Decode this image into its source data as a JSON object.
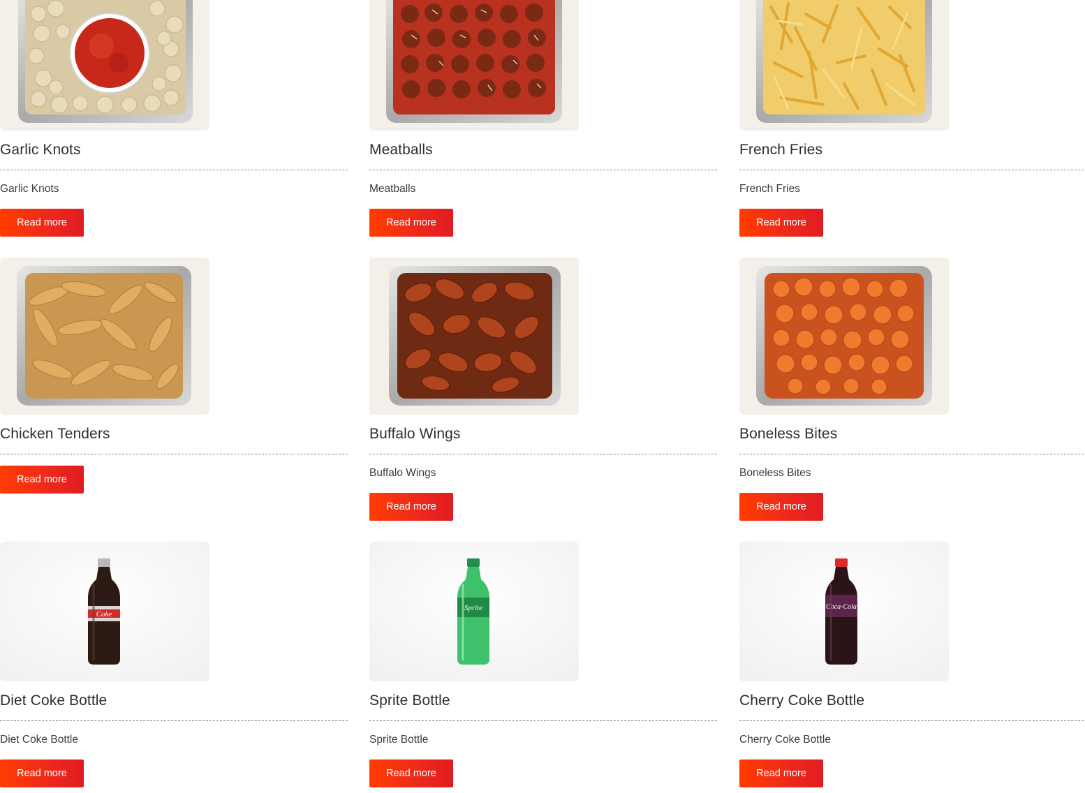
{
  "read_more_label": "Read more",
  "products": [
    {
      "title": "Garlic Knots",
      "description": "Garlic Knots",
      "image": "garlic-knots-tray-image"
    },
    {
      "title": "Meatballs",
      "description": "Meatballs",
      "image": "meatballs-tray-image"
    },
    {
      "title": "French Fries",
      "description": "French Fries",
      "image": "french-fries-tray-image"
    },
    {
      "title": "Chicken Tenders",
      "description": "",
      "image": "chicken-tenders-tray-image"
    },
    {
      "title": "Buffalo Wings",
      "description": "Buffalo Wings",
      "image": "buffalo-wings-tray-image"
    },
    {
      "title": "Boneless Bites",
      "description": "Boneless Bites",
      "image": "boneless-bites-tray-image"
    },
    {
      "title": "Diet Coke Bottle",
      "description": "Diet Coke Bottle",
      "image": "diet-coke-bottle-image"
    },
    {
      "title": "Sprite Bottle",
      "description": "Sprite Bottle",
      "image": "sprite-bottle-image"
    },
    {
      "title": "Cherry Coke Bottle",
      "description": "Cherry Coke Bottle",
      "image": "cherry-coke-bottle-image"
    }
  ],
  "colors": {
    "button_start": "#ff3d00",
    "button_end": "#e01c22",
    "heading": "#2e2e2e",
    "divider": "#8a8a8a"
  }
}
